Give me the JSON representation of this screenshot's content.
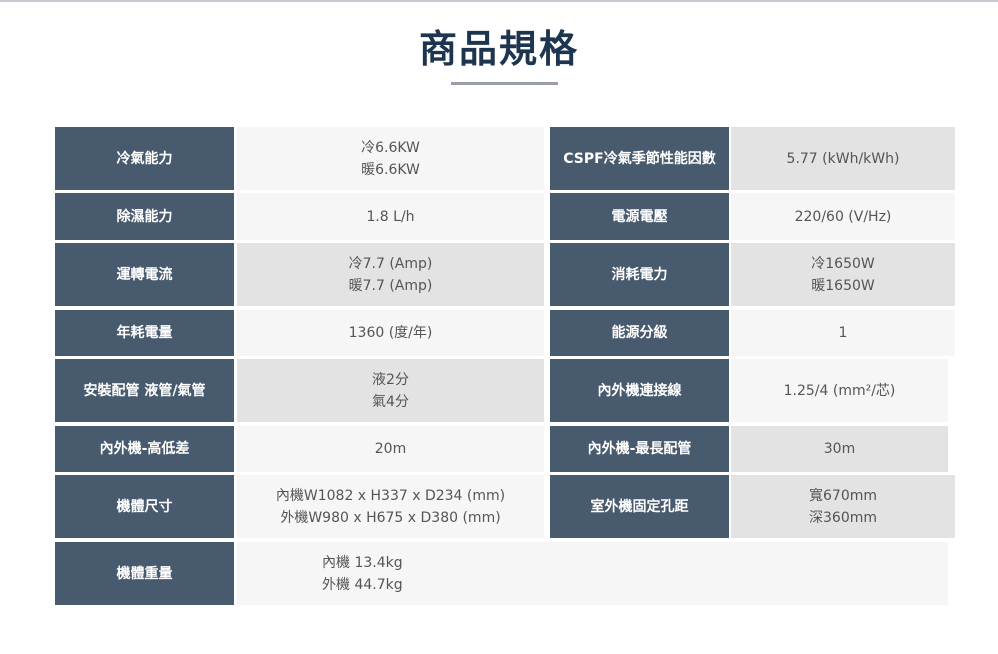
{
  "title": "商品規格",
  "specs": [
    {
      "label": "冷氣能力",
      "value": [
        "冷6.6KW",
        "暖6.6KW"
      ]
    },
    {
      "label": "CSPF冷氣季節性能因數",
      "value": [
        "5.77 (kWh/kWh)"
      ]
    },
    {
      "label": "除濕能力",
      "value": [
        "1.8 L/h"
      ]
    },
    {
      "label": "電源電壓",
      "value": [
        "220/60 (V/Hz)"
      ]
    },
    {
      "label": "運轉電流",
      "value": [
        "冷7.7 (Amp)",
        "暖7.7 (Amp)"
      ]
    },
    {
      "label": "消耗電力",
      "value": [
        "冷1650W",
        "暖1650W"
      ]
    },
    {
      "label": "年耗電量",
      "value": [
        "1360 (度/年)"
      ]
    },
    {
      "label": "能源分級",
      "value": [
        "1"
      ]
    },
    {
      "label": "安裝配管 液管/氣管",
      "value": [
        "液2分",
        "氣4分"
      ]
    },
    {
      "label": "內外機連接線",
      "value": [
        "1.25/4 (mm²/芯)"
      ]
    },
    {
      "label": "內外機-高低差",
      "value": [
        "20m"
      ]
    },
    {
      "label": "內外機-最長配管",
      "value": [
        "30m"
      ]
    },
    {
      "label": "機體尺寸",
      "value": [
        "內機W1082 x H337 x D234 (mm)",
        "外機W980 x H675 x D380 (mm)"
      ]
    },
    {
      "label": "室外機固定孔距",
      "value": [
        "寬670mm",
        "深360mm"
      ]
    },
    {
      "label": "機體重量",
      "value": [
        "內機 13.4kg",
        "外機 44.7kg"
      ]
    }
  ]
}
